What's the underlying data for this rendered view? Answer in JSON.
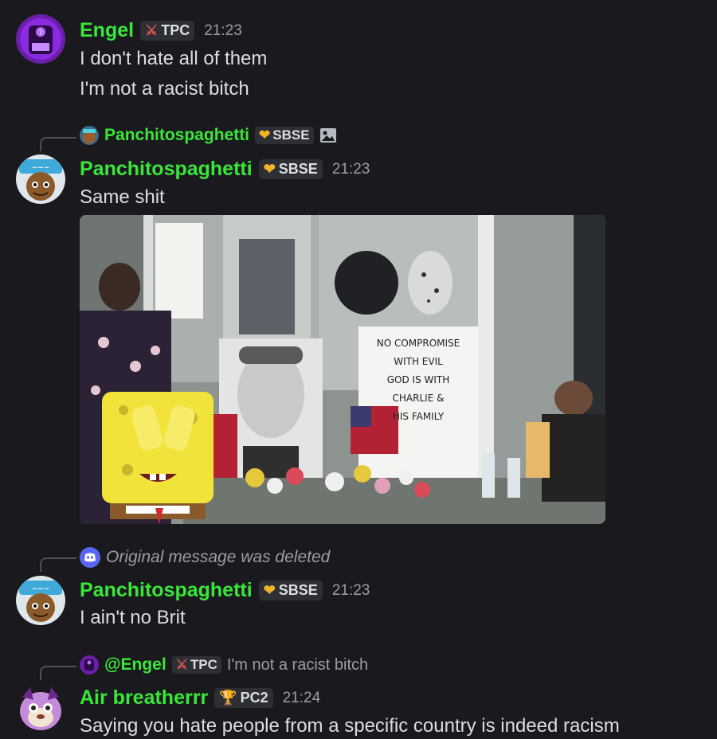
{
  "messages": [
    {
      "author": "Engel",
      "tag": "TPC",
      "time": "21:23",
      "lines": [
        "I don't hate all of them",
        "I'm not a racist bitch"
      ]
    },
    {
      "reply_to": {
        "author": "Panchitospaghetti",
        "tag": "SBSE"
      },
      "author": "Panchitospaghetti",
      "tag": "SBSE",
      "time": "21:23",
      "lines": [
        "Same shit"
      ],
      "image_sign_text": [
        "NO COMPROMISE",
        "WITH EVIL",
        "GOD IS WITH",
        "CHARLIE &",
        "HIS FAMILY"
      ]
    },
    {
      "reply_deleted": "Original message was deleted",
      "author": "Panchitospaghetti",
      "tag": "SBSE",
      "time": "21:23",
      "lines": [
        "I ain't no Brit"
      ]
    },
    {
      "reply_to": {
        "author": "@Engel",
        "tag": "TPC",
        "text": "I'm not a racist bitch"
      },
      "author": "Air breatherrr",
      "tag": "PC2",
      "time": "21:24",
      "lines": [
        "Saying you hate people from a specific country is indeed racism"
      ]
    }
  ],
  "colors": {
    "background": "#1a1a1e",
    "username": "#39e639",
    "muted": "#9b9da4"
  },
  "icons": [
    "sword-icon",
    "heart-icon",
    "image-icon",
    "discord-icon",
    "trophy-icon"
  ]
}
